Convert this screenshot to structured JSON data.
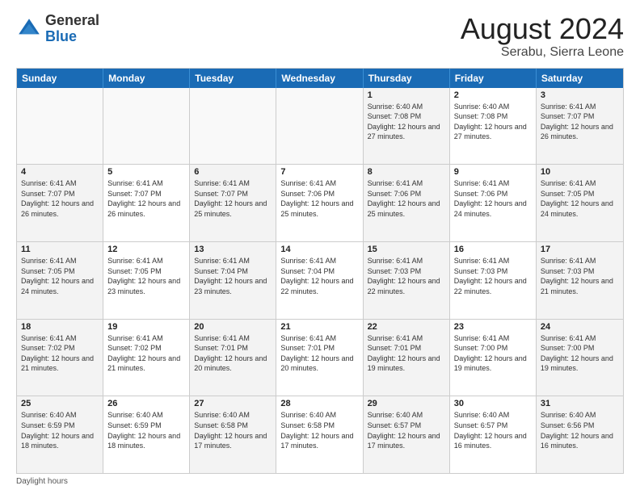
{
  "logo": {
    "general": "General",
    "blue": "Blue"
  },
  "title": {
    "month_year": "August 2024",
    "location": "Serabu, Sierra Leone"
  },
  "days_of_week": [
    "Sunday",
    "Monday",
    "Tuesday",
    "Wednesday",
    "Thursday",
    "Friday",
    "Saturday"
  ],
  "weeks": [
    [
      {
        "day": "",
        "info": ""
      },
      {
        "day": "",
        "info": ""
      },
      {
        "day": "",
        "info": ""
      },
      {
        "day": "",
        "info": ""
      },
      {
        "day": "1",
        "info": "Sunrise: 6:40 AM\nSunset: 7:08 PM\nDaylight: 12 hours and 27 minutes."
      },
      {
        "day": "2",
        "info": "Sunrise: 6:40 AM\nSunset: 7:08 PM\nDaylight: 12 hours and 27 minutes."
      },
      {
        "day": "3",
        "info": "Sunrise: 6:41 AM\nSunset: 7:07 PM\nDaylight: 12 hours and 26 minutes."
      }
    ],
    [
      {
        "day": "4",
        "info": "Sunrise: 6:41 AM\nSunset: 7:07 PM\nDaylight: 12 hours and 26 minutes."
      },
      {
        "day": "5",
        "info": "Sunrise: 6:41 AM\nSunset: 7:07 PM\nDaylight: 12 hours and 26 minutes."
      },
      {
        "day": "6",
        "info": "Sunrise: 6:41 AM\nSunset: 7:07 PM\nDaylight: 12 hours and 25 minutes."
      },
      {
        "day": "7",
        "info": "Sunrise: 6:41 AM\nSunset: 7:06 PM\nDaylight: 12 hours and 25 minutes."
      },
      {
        "day": "8",
        "info": "Sunrise: 6:41 AM\nSunset: 7:06 PM\nDaylight: 12 hours and 25 minutes."
      },
      {
        "day": "9",
        "info": "Sunrise: 6:41 AM\nSunset: 7:06 PM\nDaylight: 12 hours and 24 minutes."
      },
      {
        "day": "10",
        "info": "Sunrise: 6:41 AM\nSunset: 7:05 PM\nDaylight: 12 hours and 24 minutes."
      }
    ],
    [
      {
        "day": "11",
        "info": "Sunrise: 6:41 AM\nSunset: 7:05 PM\nDaylight: 12 hours and 24 minutes."
      },
      {
        "day": "12",
        "info": "Sunrise: 6:41 AM\nSunset: 7:05 PM\nDaylight: 12 hours and 23 minutes."
      },
      {
        "day": "13",
        "info": "Sunrise: 6:41 AM\nSunset: 7:04 PM\nDaylight: 12 hours and 23 minutes."
      },
      {
        "day": "14",
        "info": "Sunrise: 6:41 AM\nSunset: 7:04 PM\nDaylight: 12 hours and 22 minutes."
      },
      {
        "day": "15",
        "info": "Sunrise: 6:41 AM\nSunset: 7:03 PM\nDaylight: 12 hours and 22 minutes."
      },
      {
        "day": "16",
        "info": "Sunrise: 6:41 AM\nSunset: 7:03 PM\nDaylight: 12 hours and 22 minutes."
      },
      {
        "day": "17",
        "info": "Sunrise: 6:41 AM\nSunset: 7:03 PM\nDaylight: 12 hours and 21 minutes."
      }
    ],
    [
      {
        "day": "18",
        "info": "Sunrise: 6:41 AM\nSunset: 7:02 PM\nDaylight: 12 hours and 21 minutes."
      },
      {
        "day": "19",
        "info": "Sunrise: 6:41 AM\nSunset: 7:02 PM\nDaylight: 12 hours and 21 minutes."
      },
      {
        "day": "20",
        "info": "Sunrise: 6:41 AM\nSunset: 7:01 PM\nDaylight: 12 hours and 20 minutes."
      },
      {
        "day": "21",
        "info": "Sunrise: 6:41 AM\nSunset: 7:01 PM\nDaylight: 12 hours and 20 minutes."
      },
      {
        "day": "22",
        "info": "Sunrise: 6:41 AM\nSunset: 7:01 PM\nDaylight: 12 hours and 19 minutes."
      },
      {
        "day": "23",
        "info": "Sunrise: 6:41 AM\nSunset: 7:00 PM\nDaylight: 12 hours and 19 minutes."
      },
      {
        "day": "24",
        "info": "Sunrise: 6:41 AM\nSunset: 7:00 PM\nDaylight: 12 hours and 19 minutes."
      }
    ],
    [
      {
        "day": "25",
        "info": "Sunrise: 6:40 AM\nSunset: 6:59 PM\nDaylight: 12 hours and 18 minutes."
      },
      {
        "day": "26",
        "info": "Sunrise: 6:40 AM\nSunset: 6:59 PM\nDaylight: 12 hours and 18 minutes."
      },
      {
        "day": "27",
        "info": "Sunrise: 6:40 AM\nSunset: 6:58 PM\nDaylight: 12 hours and 17 minutes."
      },
      {
        "day": "28",
        "info": "Sunrise: 6:40 AM\nSunset: 6:58 PM\nDaylight: 12 hours and 17 minutes."
      },
      {
        "day": "29",
        "info": "Sunrise: 6:40 AM\nSunset: 6:57 PM\nDaylight: 12 hours and 17 minutes."
      },
      {
        "day": "30",
        "info": "Sunrise: 6:40 AM\nSunset: 6:57 PM\nDaylight: 12 hours and 16 minutes."
      },
      {
        "day": "31",
        "info": "Sunrise: 6:40 AM\nSunset: 6:56 PM\nDaylight: 12 hours and 16 minutes."
      }
    ]
  ],
  "footer": {
    "daylight_label": "Daylight hours"
  }
}
